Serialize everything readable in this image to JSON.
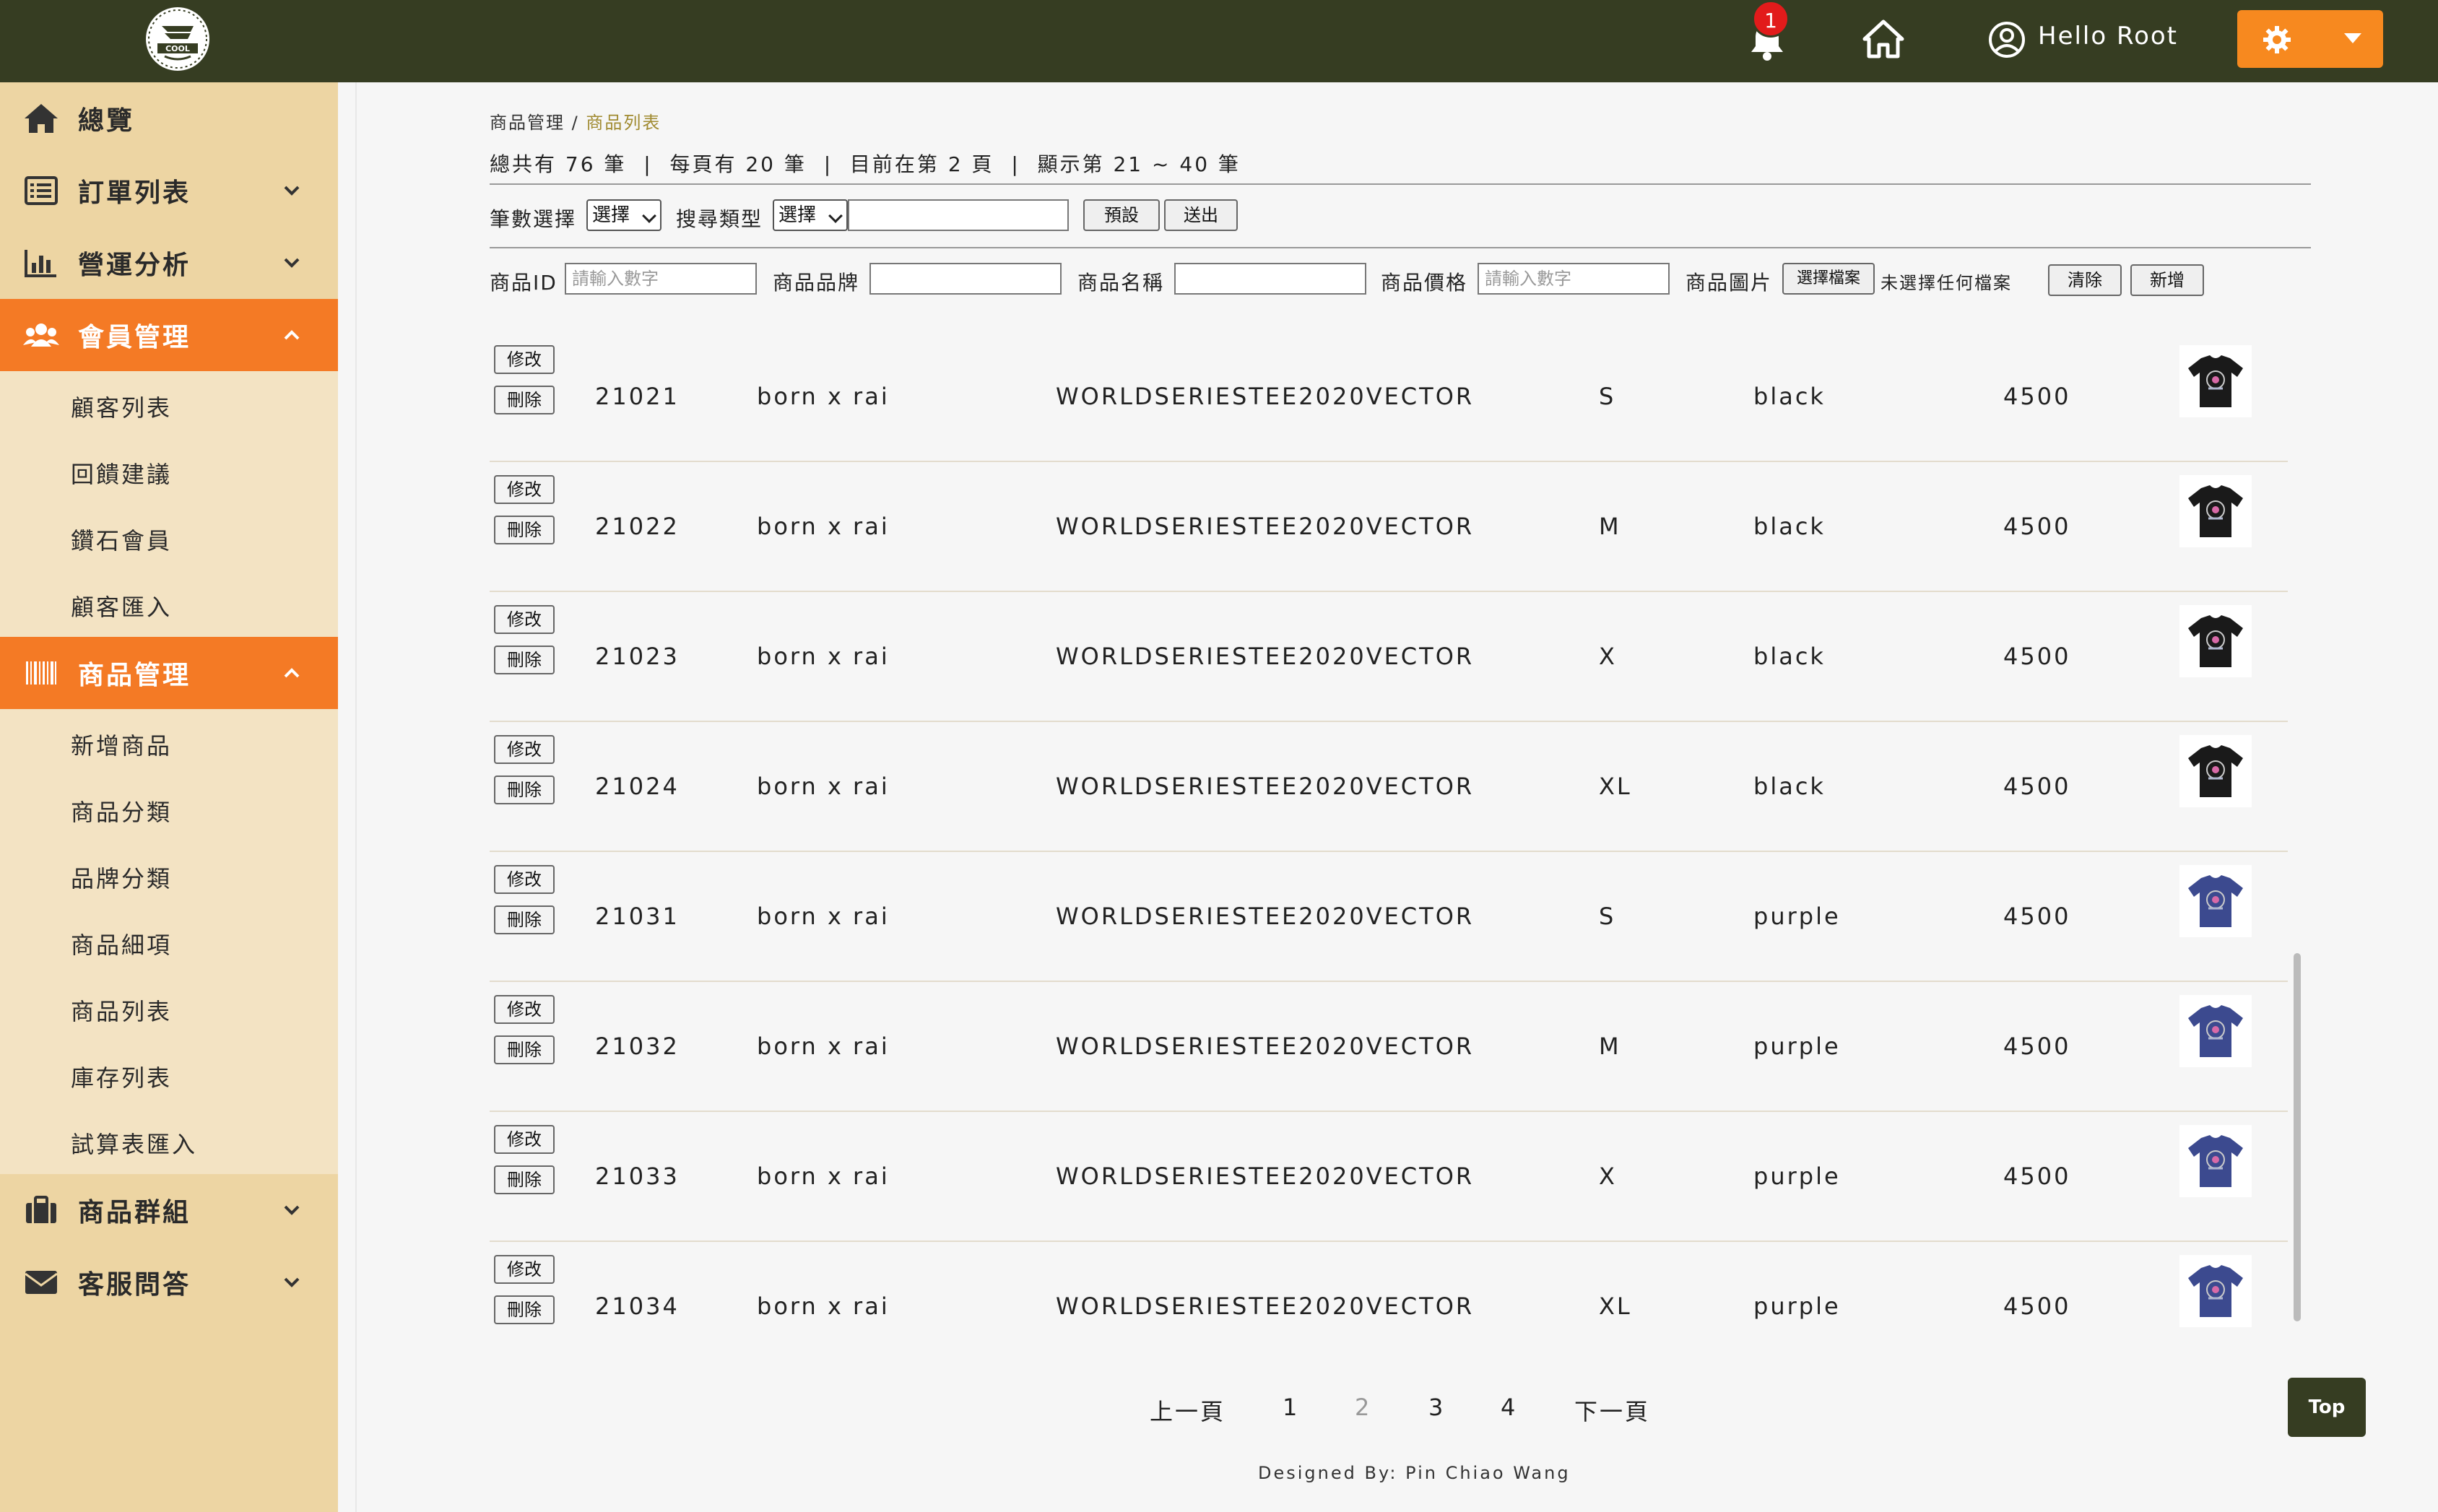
{
  "topbar": {
    "notification_count": "1",
    "greeting": "Hello Root",
    "logo_text": "COOL"
  },
  "sidebar": {
    "items": [
      {
        "label": "總覽",
        "icon": "home-icon"
      },
      {
        "label": "訂單列表",
        "icon": "list-icon"
      },
      {
        "label": "營運分析",
        "icon": "bar-chart-icon"
      },
      {
        "label": "會員管理",
        "icon": "users-icon"
      },
      {
        "label": "商品管理",
        "icon": "barcode-icon"
      },
      {
        "label": "商品群組",
        "icon": "briefcase-icon"
      },
      {
        "label": "客服問答",
        "icon": "envelope-icon"
      }
    ],
    "member_sub": [
      "顧客列表",
      "回饋建議",
      "鑽石會員",
      "顧客匯入"
    ],
    "product_sub": [
      "新增商品",
      "商品分類",
      "品牌分類",
      "商品細項",
      "商品列表",
      "庫存列表",
      "試算表匯入"
    ]
  },
  "breadcrumb": {
    "parent": "商品管理",
    "sep": "/",
    "current": "商品列表"
  },
  "stats": "總共有 76 筆  |  每頁有 20 筆  |  目前在第 2 頁  |  顯示第 21 ~ 40 筆",
  "filter": {
    "count_label": "筆數選擇",
    "count_value": "選擇",
    "search_type_label": "搜尋類型",
    "search_type_value": "選擇",
    "search_value": "",
    "preset_btn": "預設",
    "submit_btn": "送出"
  },
  "form": {
    "id_label": "商品ID",
    "id_placeholder": "請輸入數字",
    "brand_label": "商品品牌",
    "name_label": "商品名稱",
    "price_label": "商品價格",
    "price_placeholder": "請輸入數字",
    "image_label": "商品圖片",
    "choose_file_btn": "選擇檔案",
    "no_file_text": "未選擇任何檔案",
    "clear_btn": "清除",
    "add_btn": "新增"
  },
  "row_actions": {
    "edit": "修改",
    "delete": "刪除"
  },
  "rows": [
    {
      "id": "21021",
      "brand": "born x rai",
      "name": "WORLDSERIESTEE2020VECTOR",
      "size": "S",
      "color": "black",
      "price": "4500",
      "shirt_color": "#1a1a1a"
    },
    {
      "id": "21022",
      "brand": "born x rai",
      "name": "WORLDSERIESTEE2020VECTOR",
      "size": "M",
      "color": "black",
      "price": "4500",
      "shirt_color": "#1a1a1a"
    },
    {
      "id": "21023",
      "brand": "born x rai",
      "name": "WORLDSERIESTEE2020VECTOR",
      "size": "X",
      "color": "black",
      "price": "4500",
      "shirt_color": "#1a1a1a"
    },
    {
      "id": "21024",
      "brand": "born x rai",
      "name": "WORLDSERIESTEE2020VECTOR",
      "size": "XL",
      "color": "black",
      "price": "4500",
      "shirt_color": "#1a1a1a"
    },
    {
      "id": "21031",
      "brand": "born x rai",
      "name": "WORLDSERIESTEE2020VECTOR",
      "size": "S",
      "color": "purple",
      "price": "4500",
      "shirt_color": "#3c4a8f"
    },
    {
      "id": "21032",
      "brand": "born x rai",
      "name": "WORLDSERIESTEE2020VECTOR",
      "size": "M",
      "color": "purple",
      "price": "4500",
      "shirt_color": "#3c4a8f"
    },
    {
      "id": "21033",
      "brand": "born x rai",
      "name": "WORLDSERIESTEE2020VECTOR",
      "size": "X",
      "color": "purple",
      "price": "4500",
      "shirt_color": "#3c4a8f"
    },
    {
      "id": "21034",
      "brand": "born x rai",
      "name": "WORLDSERIESTEE2020VECTOR",
      "size": "XL",
      "color": "purple",
      "price": "4500",
      "shirt_color": "#3c4a8f"
    }
  ],
  "pagination": {
    "prev": "上一頁",
    "pages": [
      "1",
      "2",
      "3",
      "4"
    ],
    "current": "2",
    "next": "下一頁"
  },
  "footer": "Designed By: Pin Chiao Wang",
  "top_btn": "Top",
  "colors": {
    "topbar": "#363d22",
    "sidebar": "#edd5a3",
    "accent": "#f47a25"
  }
}
